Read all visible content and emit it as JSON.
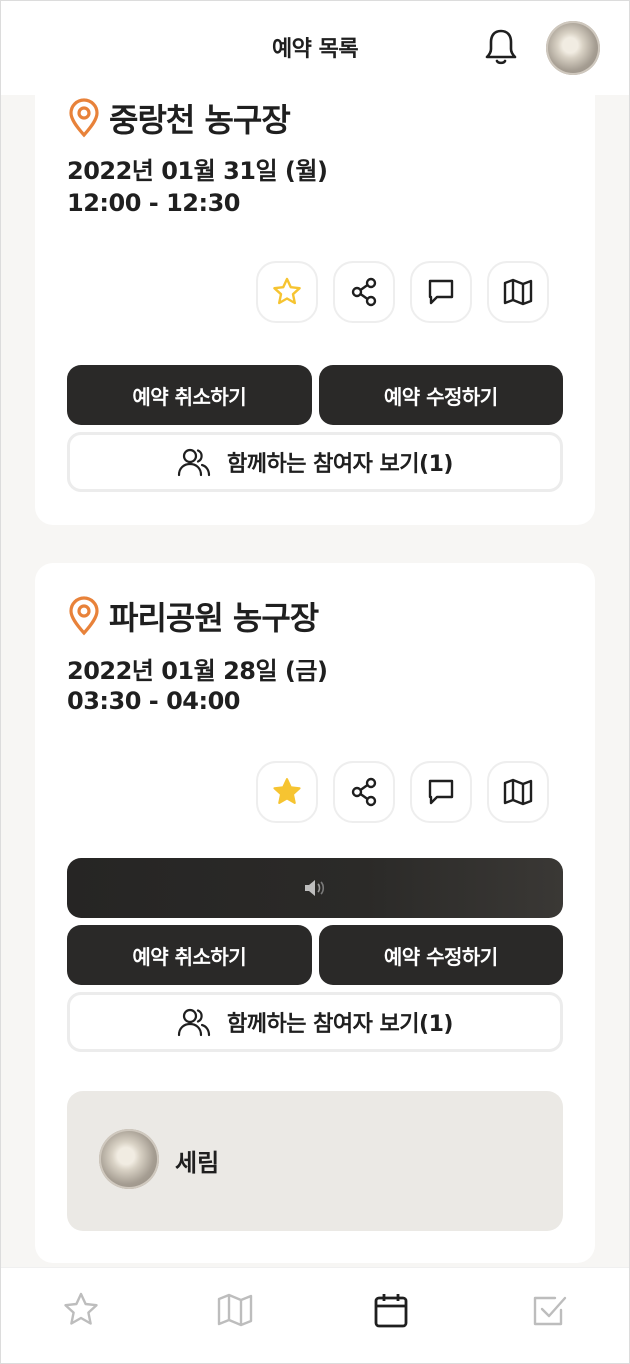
{
  "header": {
    "title": "예약 목록"
  },
  "reservations": [
    {
      "place": "중랑천 농구장",
      "date": "2022년 01월 31일 (월)",
      "time": "12:00 - 12:30",
      "favorite": false,
      "buttons": {
        "cancel": "예약 취소하기",
        "edit": "예약 수정하기",
        "participants": "함께하는 참여자 보기(1)"
      }
    },
    {
      "place": "파리공원 농구장",
      "date": "2022년 01월 28일 (금)",
      "time": "03:30 - 04:00",
      "favorite": true,
      "audio_icon": "speaker-icon",
      "buttons": {
        "cancel": "예약 취소하기",
        "edit": "예약 수정하기",
        "participants": "함께하는 참여자 보기(1)"
      },
      "participants": [
        {
          "name": "세림"
        }
      ]
    }
  ],
  "colors": {
    "accent_orange": "#e8823a",
    "star_yellow": "#f6c431",
    "dark_button": "#2a2928",
    "participant_bg": "#ebe9e5"
  },
  "bottom_nav": [
    "star-icon",
    "map-icon",
    "calendar-icon",
    "checkbox-icon"
  ]
}
